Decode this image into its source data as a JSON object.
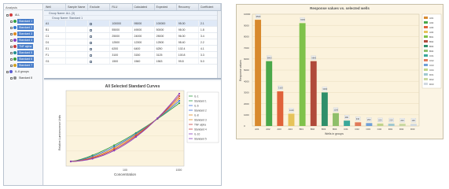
{
  "left_window": {
    "sidebar_header": "Analysis",
    "tree": [
      {
        "label": "ALL",
        "color": "#d23c3c",
        "selected": false
      },
      {
        "label": "Standard 1",
        "color": "#2f9e44",
        "selected": true
      },
      {
        "label": "Standard 2",
        "color": "#2f77d2",
        "selected": true
      },
      {
        "label": "Standard 3",
        "color": "#e08a1e",
        "selected": true
      },
      {
        "label": "Standard 4",
        "color": "#8a3fbf",
        "selected": true
      },
      {
        "label": "TNF alpha",
        "color": "#c83c3c",
        "selected": true
      },
      {
        "label": "Standard 5",
        "color": "#1f8f8f",
        "selected": true
      },
      {
        "label": "Standard 6",
        "color": "#3a9e3a",
        "selected": true
      },
      {
        "label": "Standard 7",
        "color": "#d2a21e",
        "selected": true
      },
      {
        "label": "IL-6 groups",
        "color": "#5a5ad2",
        "selected": false
      },
      {
        "label": "Standard 8",
        "color": "#888888",
        "selected": false
      }
    ],
    "grid": {
      "columns": [
        "Well",
        "Sample Name",
        "Exclude",
        "RLU",
        "Calculated",
        "Expected",
        "Recovery",
        "Coefficient"
      ],
      "group1": "Group Name: ALL (3)",
      "group2": "Group Name: Standard 1",
      "rows": [
        [
          "A1",
          "",
          "",
          "100000",
          "95000",
          "100000",
          "95.00",
          "2.1"
        ],
        [
          "B1",
          "",
          "",
          "55000",
          "49000",
          "50000",
          "98.00",
          "1.8"
        ],
        [
          "C1",
          "",
          "",
          "25000",
          "24000",
          "25000",
          "96.00",
          "3.4"
        ],
        [
          "D1",
          "",
          "",
          "12500",
          "12300",
          "12500",
          "98.40",
          "2.2"
        ],
        [
          "E1",
          "",
          "",
          "6200",
          "6400",
          "6250",
          "102.4",
          "4.1"
        ],
        [
          "F1",
          "",
          "",
          "3100",
          "3150",
          "3125",
          "100.8",
          "3.3"
        ],
        [
          "G1",
          "",
          "",
          "1500",
          "1560",
          "1563",
          "99.8",
          "5.0"
        ]
      ]
    },
    "plot": {
      "title": "All Selected Standard Curves",
      "xlabel": "Concentration",
      "ylabel": "Relative Luminescence Units",
      "x_ticks": [
        "100",
        "1000"
      ],
      "legend": [
        "IL-1",
        "Standard 1",
        "IL-6",
        "Standard 2",
        "IL-8",
        "Standard 3",
        "TNF alpha",
        "Standard 4",
        "IL-10",
        "Standard 5"
      ],
      "legend_colors": [
        "#2f9e44",
        "#2f9e44",
        "#3a6fd8",
        "#3a6fd8",
        "#e08a1e",
        "#e08a1e",
        "#c83c3c",
        "#c83c3c",
        "#8a3fbf",
        "#8a3fbf"
      ],
      "curve_colors": [
        "#2f9e44",
        "#3a6fd8",
        "#e08a1e",
        "#c83c3c",
        "#8a3fbf"
      ]
    }
  },
  "chart_data": {
    "type": "bar",
    "title": "Response values vs. selected wells",
    "xlabel": "Wells in groups",
    "ylabel": "Response values",
    "categories": [
      "A01",
      "A02",
      "A03",
      "A04",
      "B01",
      "B02",
      "B03",
      "B04",
      "C01",
      "C02",
      "C03",
      "C04",
      "D01",
      "D02",
      "D03"
    ],
    "values": [
      9500,
      5800,
      3100,
      1100,
      9200,
      5800,
      3000,
      1150,
      480,
      330,
      260,
      220,
      210,
      200,
      190
    ],
    "data_labels": [
      "9500",
      "5800",
      "3100",
      "1100",
      "9200",
      "5800",
      "3000",
      "1150",
      "480",
      "330",
      "260",
      "220",
      "210",
      "200",
      "190"
    ],
    "colors": [
      "#d88a2e",
      "#4aa84a",
      "#e0623a",
      "#e6c35a",
      "#7fc24a",
      "#b04a3a",
      "#2f8f6a",
      "#8fbf6a",
      "#3aa89a",
      "#e07a5a",
      "#6fa0d8",
      "#bfd48a",
      "#a0c8d0",
      "#c8d8a0",
      "#d0d8e0"
    ],
    "legend": [
      "A01",
      "A02",
      "A03",
      "A04",
      "B01",
      "B02",
      "B03",
      "B04",
      "C01",
      "C02",
      "C03",
      "C04",
      "D01",
      "D02",
      "D03"
    ],
    "y_ticks": [
      "0",
      "1000",
      "2000",
      "3000",
      "4000",
      "5000",
      "6000",
      "7000",
      "8000",
      "9000",
      "10000"
    ],
    "ylim": [
      0,
      10000
    ],
    "grid": true,
    "legend_position": "right"
  }
}
